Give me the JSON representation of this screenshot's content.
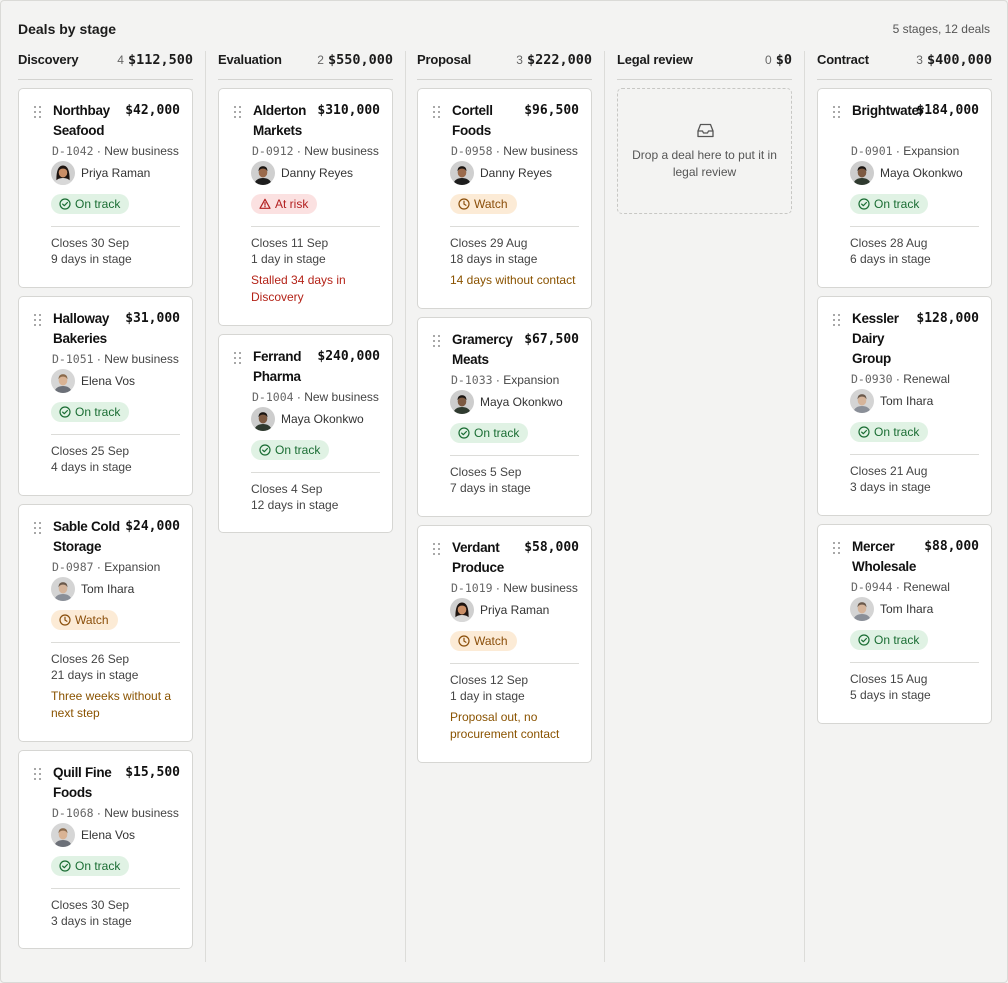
{
  "board": {
    "title": "Deals by stage",
    "summary": "5 stages, 12 deals"
  },
  "columns": [
    {
      "name": "Discovery",
      "count": "4",
      "total": "$112,500",
      "cards": [
        {
          "name": "Northbay Seafood",
          "amount": "$42,000",
          "id": "D-1042",
          "type": "New business",
          "owner": "Priya Raman",
          "status": "On track",
          "closes": "Closes 30 Sep",
          "days": "9 days in stage"
        },
        {
          "name": "Halloway Bakeries",
          "amount": "$31,000",
          "id": "D-1051",
          "type": "New business",
          "owner": "Elena Vos",
          "status": "On track",
          "closes": "Closes 25 Sep",
          "days": "4 days in stage"
        },
        {
          "name": "Sable Cold Storage",
          "amount": "$24,000",
          "id": "D-0987",
          "type": "Expansion",
          "owner": "Tom Ihara",
          "status": "Watch",
          "closes": "Closes 26 Sep",
          "days": "21 days in stage",
          "warning": "Three weeks without a next step"
        },
        {
          "name": "Quill Fine Foods",
          "amount": "$15,500",
          "id": "D-1068",
          "type": "New business",
          "owner": "Elena Vos",
          "status": "On track",
          "closes": "Closes 30 Sep",
          "days": "3 days in stage"
        }
      ]
    },
    {
      "name": "Evaluation",
      "count": "2",
      "total": "$550,000",
      "cards": [
        {
          "name": "Alderton Markets",
          "amount": "$310,000",
          "id": "D-0912",
          "type": "New business",
          "owner": "Danny Reyes",
          "status": "At risk",
          "closes": "Closes 11 Sep",
          "days": "1 day in stage",
          "warning": "Stalled 34 days in Discovery"
        },
        {
          "name": "Ferrand Pharma",
          "amount": "$240,000",
          "id": "D-1004",
          "type": "New business",
          "owner": "Maya Okonkwo",
          "status": "On track",
          "closes": "Closes 4 Sep",
          "days": "12 days in stage"
        }
      ]
    },
    {
      "name": "Proposal",
      "count": "3",
      "total": "$222,000",
      "cards": [
        {
          "name": "Cortell Foods",
          "amount": "$96,500",
          "id": "D-0958",
          "type": "New business",
          "owner": "Danny Reyes",
          "status": "Watch",
          "closes": "Closes 29 Aug",
          "days": "18 days in stage",
          "warning": "14 days without contact"
        },
        {
          "name": "Gramercy Meats",
          "amount": "$67,500",
          "id": "D-1033",
          "type": "Expansion",
          "owner": "Maya Okonkwo",
          "status": "On track",
          "closes": "Closes 5 Sep",
          "days": "7 days in stage"
        },
        {
          "name": "Verdant Produce",
          "amount": "$58,000",
          "id": "D-1019",
          "type": "New business",
          "owner": "Priya Raman",
          "status": "Watch",
          "closes": "Closes 12 Sep",
          "days": "1 day in stage",
          "warning": "Proposal out, no procurement contact"
        }
      ]
    },
    {
      "name": "Legal review",
      "count": "0",
      "total": "$0",
      "empty_text": "Drop a deal here to put it in legal review",
      "cards": []
    },
    {
      "name": "Contract",
      "count": "3",
      "total": "$400,000",
      "cards": [
        {
          "name": "Brightwater Grocers",
          "amount": "$184,000",
          "id": "D-0901",
          "type": "Expansion",
          "owner": "Maya Okonkwo",
          "status": "On track",
          "closes": "Closes 28 Aug",
          "days": "6 days in stage"
        },
        {
          "name": "Kessler Dairy Group",
          "amount": "$128,000",
          "id": "D-0930",
          "type": "Renewal",
          "owner": "Tom Ihara",
          "status": "On track",
          "closes": "Closes 21 Aug",
          "days": "3 days in stage"
        },
        {
          "name": "Mercer Wholesale",
          "amount": "$88,000",
          "id": "D-0944",
          "type": "Renewal",
          "owner": "Tom Ihara",
          "status": "On track",
          "closes": "Closes 15 Aug",
          "days": "5 days in stage"
        }
      ]
    }
  ],
  "status_styles": {
    "On track": {
      "color": "#1a6d33",
      "background": "#e0f2e4",
      "icon": "check-circle-icon"
    },
    "Watch": {
      "color": "#8a4e0a",
      "background": "#fcebd6",
      "icon": "clock-icon"
    },
    "At risk": {
      "color": "#b32020",
      "background": "#fbe1e1",
      "icon": "warning-triangle-icon"
    }
  },
  "avatar_icon": "person-avatar-icon",
  "drag_icon": "drag-handle-icon",
  "empty_icon": "inbox-tray-icon"
}
